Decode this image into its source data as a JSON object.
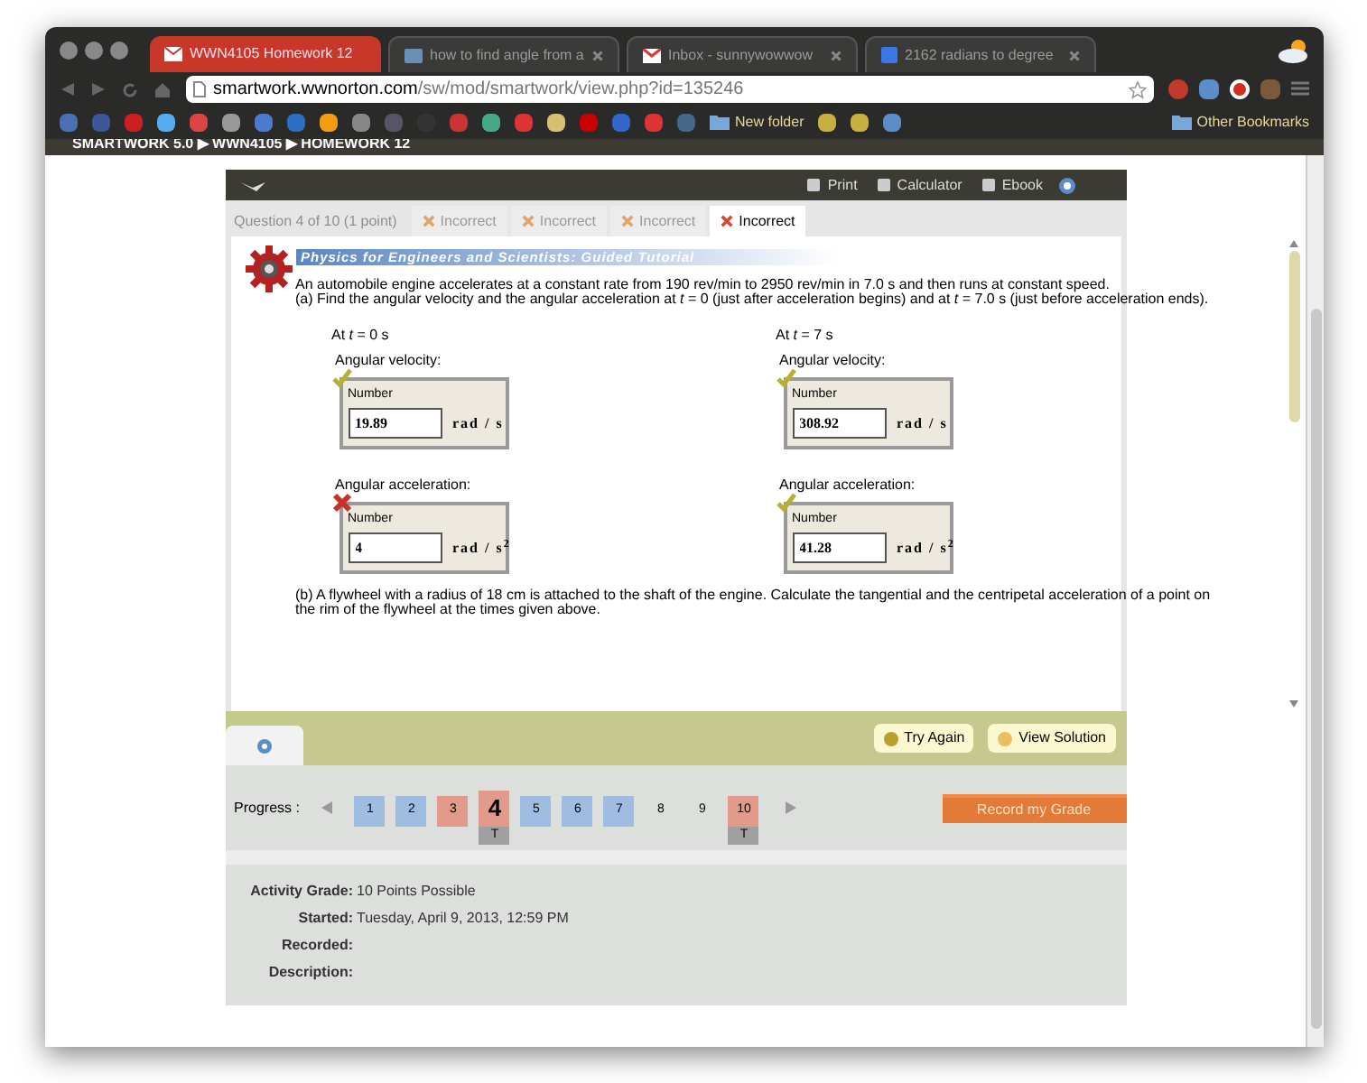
{
  "browser_tabs": [
    {
      "title": "WWN4105  Homework 12",
      "selected": true
    },
    {
      "title": "how to find angle from a",
      "selected": false
    },
    {
      "title": "Inbox - sunnywowwow",
      "selected": false
    },
    {
      "title": "2162 radians to degree",
      "selected": false
    }
  ],
  "address": {
    "host": "smartwork.wwnorton.com",
    "path": "/sw/mod/smartwork/view.php?id=135246"
  },
  "bookmarks": {
    "folder": "New folder",
    "other": "Other Bookmarks"
  },
  "breadcrumb": "SMARTWORK 5.0 ▶ WWN4105 ▶ HOMEWORK 12",
  "toolbar": [
    "Print",
    "Calculator",
    "Ebook"
  ],
  "question_label": "Question 4 of 10 (1 point)",
  "question_tabs": [
    {
      "label": "Incorrect",
      "selected": false
    },
    {
      "label": "Incorrect",
      "selected": false
    },
    {
      "label": "Incorrect",
      "selected": false
    },
    {
      "label": "Incorrect",
      "selected": true
    }
  ],
  "tutorial_title": "Physics for Engineers and Scientists: Guided Tutorial",
  "question": "An automobile engine accelerates at a constant rate from 190 rev/min to 2950 rev/min in 7.0 s and then runs at constant speed.",
  "part_a": "(a) Find the angular velocity and the angular acceleration at *t* = 0 (just after acceleration begins) and at *t* = 7.0 s (just before acceleration ends).",
  "columns": [
    {
      "heading": "At *t* = 0 s",
      "answers": [
        {
          "label": "Angular velocity:",
          "field_label": "Number",
          "value": "19.89",
          "unit": "rad / s",
          "correct": true
        },
        {
          "label": "Angular acceleration:",
          "field_label": "Number",
          "value": "4",
          "unit": "rad / s$^{2}$",
          "correct": false
        }
      ]
    },
    {
      "heading": "At *t* = 7 s",
      "answers": [
        {
          "label": "Angular velocity:",
          "field_label": "Number",
          "value": "308.92",
          "unit": "rad / s",
          "correct": true
        },
        {
          "label": "Angular acceleration:",
          "field_label": "Number",
          "value": "41.28",
          "unit": "rad / s$^{2}$",
          "correct": true
        }
      ]
    }
  ],
  "part_b": "(b) A flywheel with a radius of 18 cm is attached to the shaft of the engine. Calculate the tangential and the centripetal acceleration of a point on the rim of the flywheel at the times given above.",
  "actions": [
    "Try Again",
    "View Solution"
  ],
  "progress": {
    "label": "Progress :",
    "items": [
      {
        "number": "1",
        "color": "#9fbde0",
        "selected": false
      },
      {
        "number": "2",
        "color": "#9fbde0",
        "selected": false
      },
      {
        "number": "3",
        "color": "#e29a8a",
        "selected": false
      },
      {
        "number": "4",
        "color": "#e29a8a",
        "selected": true,
        "badge": "T"
      },
      {
        "number": "5",
        "color": "#9fbde0",
        "selected": false
      },
      {
        "number": "6",
        "color": "#9fbde0",
        "selected": false
      },
      {
        "number": "7",
        "color": "#9fbde0",
        "selected": false
      },
      {
        "number": "8",
        "selected": false
      },
      {
        "number": "9",
        "selected": false
      },
      {
        "number": "10",
        "color": "#e29a8a",
        "selected": false,
        "badge": "T"
      }
    ],
    "button": "Record my Grade"
  },
  "info": [
    {
      "label": "Activity Grade:",
      "value": "10 Points Possible"
    },
    {
      "label": "Started:",
      "value": "Tuesday, April 9, 2013, 12:59 PM"
    },
    {
      "label": "Recorded:"
    },
    {
      "label": "Description:"
    }
  ]
}
